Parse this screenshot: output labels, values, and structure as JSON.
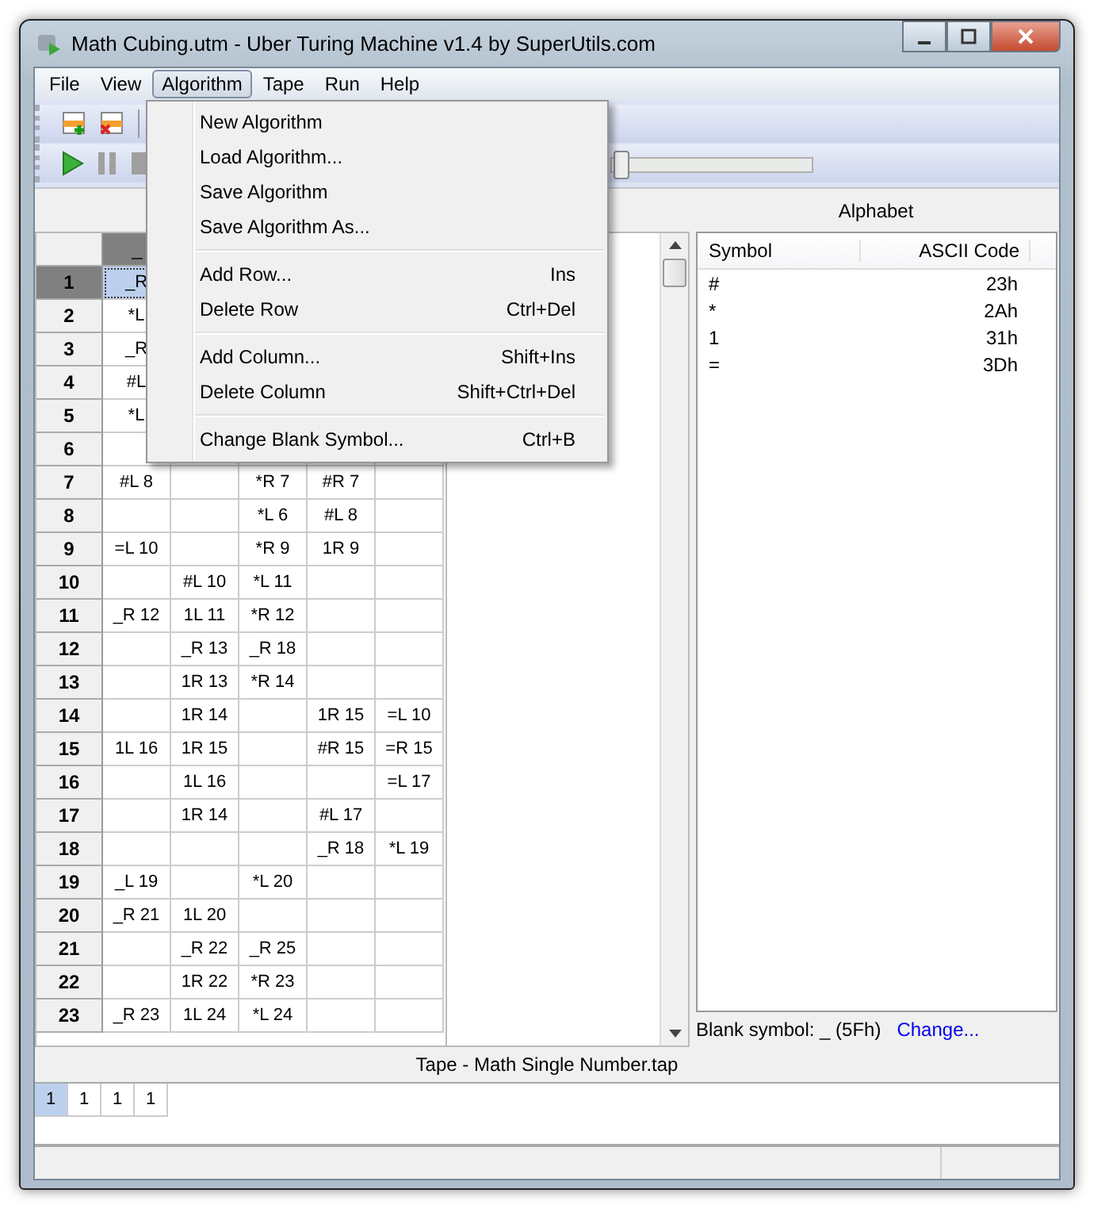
{
  "window": {
    "title": "Math Cubing.utm - Uber Turing Machine v1.4 by SuperUtils.com"
  },
  "menubar": [
    {
      "label": "File",
      "selected": false
    },
    {
      "label": "View",
      "selected": false
    },
    {
      "label": "Algorithm",
      "selected": true
    },
    {
      "label": "Tape",
      "selected": false
    },
    {
      "label": "Run",
      "selected": false
    },
    {
      "label": "Help",
      "selected": false
    }
  ],
  "open_menu": {
    "groups": [
      [
        {
          "label": "New Algorithm"
        },
        {
          "label": "Load Algorithm..."
        },
        {
          "label": "Save Algorithm"
        },
        {
          "label": "Save Algorithm As..."
        }
      ],
      [
        {
          "label": "Add Row...",
          "shortcut": "Ins"
        },
        {
          "label": "Delete Row",
          "shortcut": "Ctrl+Del"
        }
      ],
      [
        {
          "label": "Add Column...",
          "shortcut": "Shift+Ins"
        },
        {
          "label": "Delete Column",
          "shortcut": "Shift+Ctrl+Del"
        }
      ],
      [
        {
          "label": "Change Blank Symbol...",
          "shortcut": "Ctrl+B"
        }
      ]
    ]
  },
  "speed_slider": {
    "level": 0.02
  },
  "alphabet": {
    "title": "Alphabet",
    "columns": [
      "Symbol",
      "ASCII Code"
    ],
    "rows": [
      [
        "#",
        "23h"
      ],
      [
        "*",
        "2Ah"
      ],
      [
        "1",
        "31h"
      ],
      [
        "=",
        "3Dh"
      ]
    ],
    "blank_label": "Blank symbol: _ (5Fh)",
    "change_link": "Change..."
  },
  "table": {
    "columns": [
      {
        "label": "_",
        "selected": true
      }
    ],
    "rows": [
      {
        "number": "1",
        "selected": true,
        "cells": [
          "_R",
          null,
          null,
          null,
          null
        ]
      },
      {
        "number": "2",
        "selected": false,
        "cells": [
          "*L",
          null,
          null,
          null,
          null
        ]
      },
      {
        "number": "3",
        "selected": false,
        "cells": [
          "_R",
          null,
          null,
          null,
          null
        ]
      },
      {
        "number": "4",
        "selected": false,
        "cells": [
          "#L",
          null,
          null,
          null,
          null
        ]
      },
      {
        "number": "5",
        "selected": false,
        "cells": [
          "*L",
          null,
          null,
          null,
          null
        ]
      },
      {
        "number": "6",
        "selected": false,
        "cells": [
          null,
          null,
          null,
          null,
          null
        ]
      },
      {
        "number": "7",
        "selected": false,
        "cells": [
          "#L 8",
          null,
          "*R 7",
          "#R 7",
          null
        ]
      },
      {
        "number": "8",
        "selected": false,
        "cells": [
          null,
          null,
          "*L 6",
          "#L 8",
          null
        ]
      },
      {
        "number": "9",
        "selected": false,
        "cells": [
          "=L 10",
          null,
          "*R 9",
          "1R 9",
          null
        ]
      },
      {
        "number": "10",
        "selected": false,
        "cells": [
          null,
          "#L 10",
          "*L 11",
          null,
          null
        ]
      },
      {
        "number": "11",
        "selected": false,
        "cells": [
          "_R 12",
          "1L 11",
          "*R 12",
          null,
          null
        ]
      },
      {
        "number": "12",
        "selected": false,
        "cells": [
          null,
          "_R 13",
          "_R 18",
          null,
          null
        ]
      },
      {
        "number": "13",
        "selected": false,
        "cells": [
          null,
          "1R 13",
          "*R 14",
          null,
          null
        ]
      },
      {
        "number": "14",
        "selected": false,
        "cells": [
          null,
          "1R 14",
          null,
          "1R 15",
          "=L 10"
        ]
      },
      {
        "number": "15",
        "selected": false,
        "cells": [
          "1L 16",
          "1R 15",
          null,
          "#R 15",
          "=R 15"
        ]
      },
      {
        "number": "16",
        "selected": false,
        "cells": [
          null,
          "1L 16",
          null,
          null,
          "=L 17"
        ]
      },
      {
        "number": "17",
        "selected": false,
        "cells": [
          null,
          "1R 14",
          null,
          "#L 17",
          null
        ]
      },
      {
        "number": "18",
        "selected": false,
        "cells": [
          null,
          null,
          null,
          "_R 18",
          "*L 19"
        ]
      },
      {
        "number": "19",
        "selected": false,
        "cells": [
          "_L 19",
          null,
          "*L 20",
          null,
          null
        ]
      },
      {
        "number": "20",
        "selected": false,
        "cells": [
          "_R 21",
          "1L 20",
          null,
          null,
          null
        ]
      },
      {
        "number": "21",
        "selected": false,
        "cells": [
          null,
          "_R 22",
          "_R 25",
          null,
          null
        ]
      },
      {
        "number": "22",
        "selected": false,
        "cells": [
          null,
          "1R 22",
          "*R 23",
          null,
          null
        ]
      },
      {
        "number": "23",
        "selected": false,
        "cells": [
          "_R 23",
          "1L 24",
          "*L 24",
          null,
          null
        ]
      }
    ]
  },
  "tape": {
    "title": "Tape - Math Single Number.tap",
    "cells": [
      {
        "symbol": "1",
        "selected": true
      },
      {
        "symbol": "1",
        "selected": false
      },
      {
        "symbol": "1",
        "selected": false
      },
      {
        "symbol": "1",
        "selected": false
      }
    ]
  }
}
